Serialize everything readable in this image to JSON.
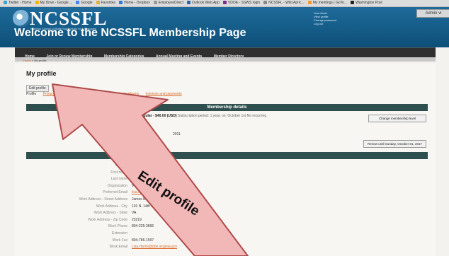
{
  "bookmarks": [
    {
      "label": "Twitter - Home",
      "icon": "twitter-icon",
      "color": "#3aa0d8"
    },
    {
      "label": "My Drive - Google ...",
      "icon": "drive-icon",
      "color": "#f4b400"
    },
    {
      "label": "Google",
      "icon": "google-icon",
      "color": "#4285f4"
    },
    {
      "label": "Favorites",
      "icon": "folder-icon",
      "color": "#e0b040"
    },
    {
      "label": "Home - Dropbox",
      "icon": "dropbox-icon",
      "color": "#2a7ae2"
    },
    {
      "label": "EmployeeDirect",
      "icon": "page-icon",
      "color": "#9a9a9a"
    },
    {
      "label": "Outlook Web App",
      "icon": "outlook-icon",
      "color": "#2a62b8"
    },
    {
      "label": "VDOE - SSWS login",
      "icon": "vdoe-icon",
      "color": "#7a2d8c"
    },
    {
      "label": "NCSSFL - Wild Apric...",
      "icon": "page-icon",
      "color": "#888888"
    },
    {
      "label": "My meetings | GoTo...",
      "icon": "goto-icon",
      "color": "#f29b26"
    },
    {
      "label": "Washington Post",
      "icon": "wp-icon",
      "color": "#222222"
    }
  ],
  "header": {
    "logo_text": "NCSSFL",
    "logo_tagline": "National Council of State Supervisors for Languages",
    "welcome": "Welcome to the NCSSFL Membership Page",
    "user_links": [
      "Lisa Harris",
      "View profile",
      "Change password",
      "Log out"
    ],
    "admin_label": "Admin vi"
  },
  "nav": [
    "Home",
    "Join or Renew Membership",
    "Membership Categories",
    "Annual Meeting and Events",
    "Member Directory"
  ],
  "breadcrumb": {
    "home": "Home",
    "current": "My profile"
  },
  "page_title": "My profile",
  "tabs": {
    "edit_profile": "Edit profile",
    "my_directory": "My directory",
    "profile": "Profile",
    "privacy": "Privacy",
    "member_photo_albums": "Member photo albums",
    "invoices": "Invoices and payments"
  },
  "membership": {
    "section_title": "Membership details",
    "level_name": "Regular - $40.00 (USD)",
    "level_note": "Subscription period: 1 year, on: October 1st No recurring",
    "date_fragment": "2011",
    "change_button": "Change membership level",
    "renew_button": "Renew until Sunday, October 01, 2017"
  },
  "fields": [
    {
      "label": "User ID",
      "value": ""
    },
    {
      "label": "First name",
      "value": "Lisa"
    },
    {
      "label": "Last name",
      "value": "Harris"
    },
    {
      "label": "Organization",
      "value": "Virginia Department of Education"
    },
    {
      "label": "Preferred Email",
      "value": "lisa.harris@doe.virginia.gov",
      "link": true
    },
    {
      "label": "Work Address - Street Address",
      "value": "James Monroe Building"
    },
    {
      "label": "Work Address - City",
      "value": "101 N. 14th Street"
    },
    {
      "label": "Work Address - State",
      "value": "VA"
    },
    {
      "label": "Work Address - Zip Code",
      "value": "23219"
    },
    {
      "label": "Work Phone",
      "value": "804-225-3666"
    },
    {
      "label": "Extension",
      "value": ""
    },
    {
      "label": "Work Fax",
      "value": "804-786-1597"
    },
    {
      "label": "Work Email",
      "value": "Lisa.Harris@doe.virginia.gov",
      "link": true
    }
  ],
  "annotation": {
    "text": "Edit profile",
    "arrow_color": "#f2b8b8",
    "arrow_outline": "#b04a4a"
  }
}
